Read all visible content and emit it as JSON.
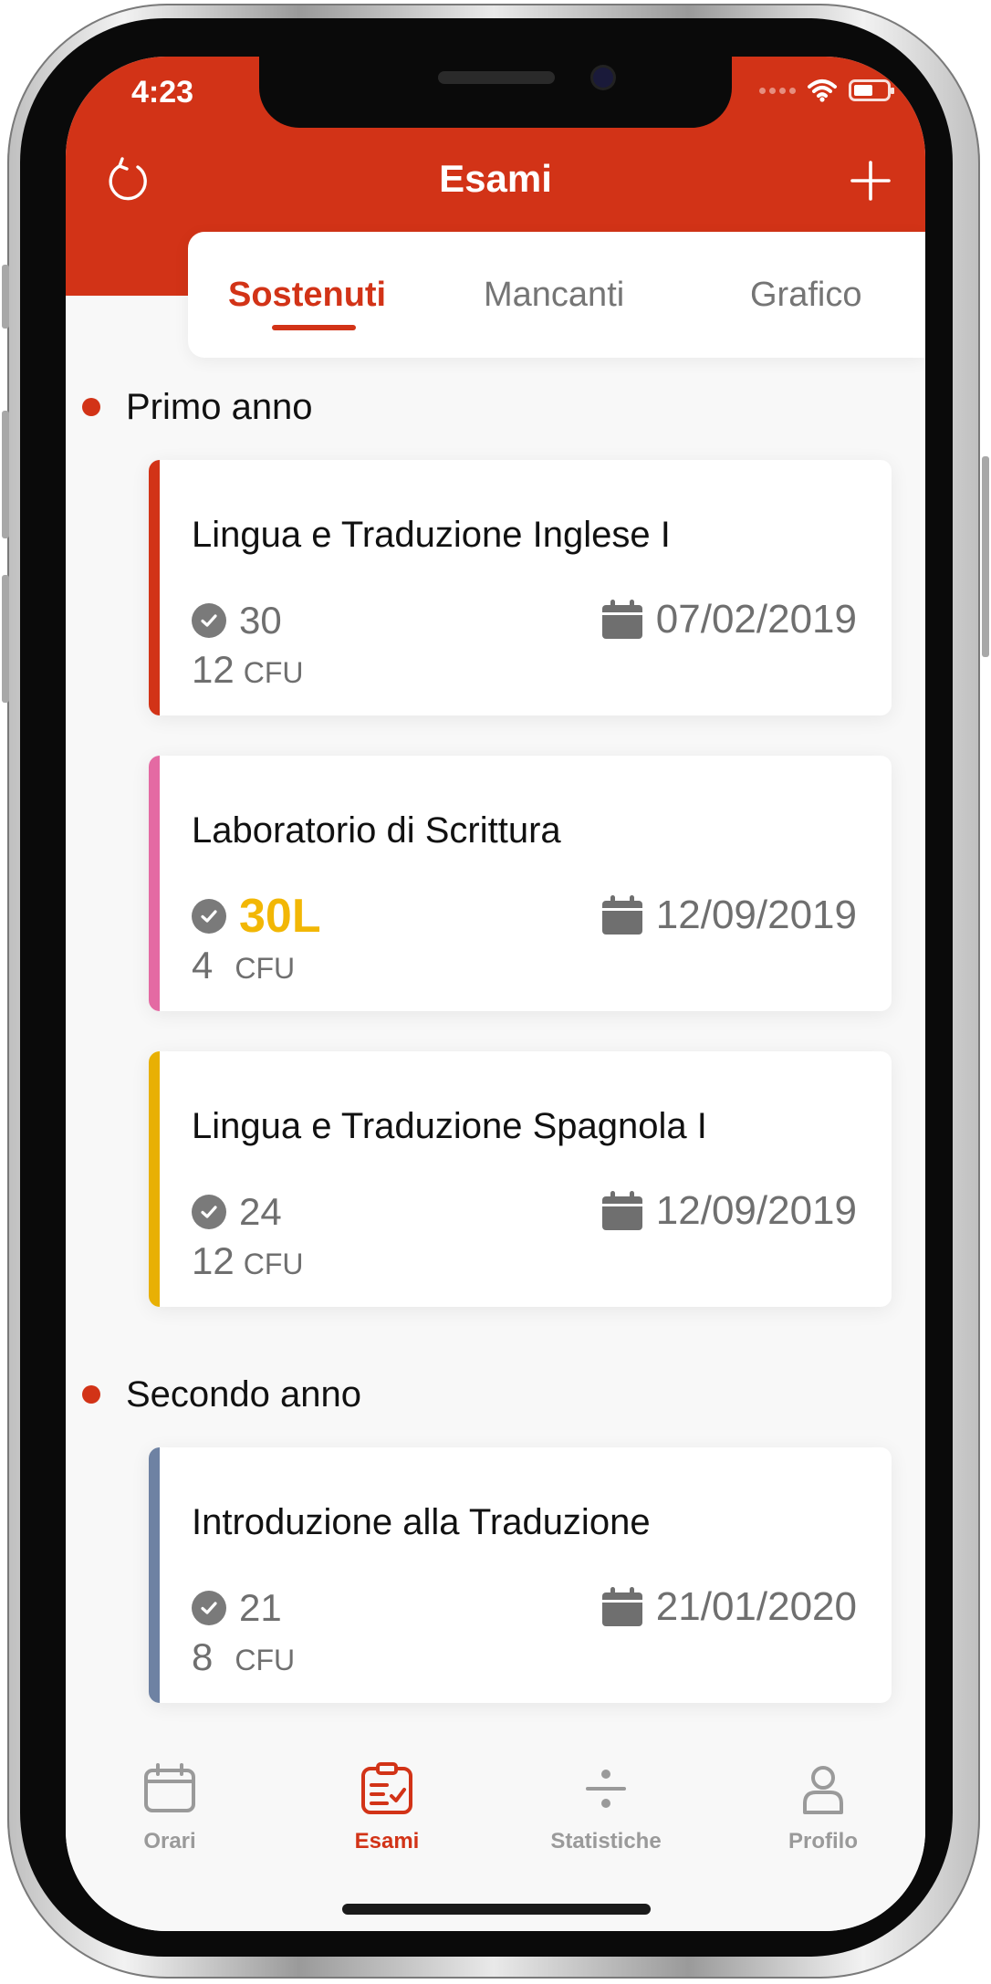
{
  "status_bar": {
    "time": "4:23"
  },
  "header": {
    "title": "Esami"
  },
  "tabs": [
    {
      "label": "Sostenuti",
      "active": true
    },
    {
      "label": "Mancanti",
      "active": false
    },
    {
      "label": "Grafico",
      "active": false
    }
  ],
  "sections": [
    {
      "title": "Primo anno",
      "exams": [
        {
          "name": "Lingua e Traduzione Inglese I",
          "grade": "30",
          "cfu": "12",
          "cfu_label": "CFU",
          "date": "07/02/2019",
          "accent": "#d23317"
        },
        {
          "name": "Laboratorio di Scrittura",
          "grade": "30L",
          "cfu": "4",
          "cfu_label": "CFU",
          "date": "12/09/2019",
          "accent": "#e46aa3"
        },
        {
          "name": "Lingua e Traduzione Spagnola I",
          "grade": "24",
          "cfu": "12",
          "cfu_label": "CFU",
          "date": "12/09/2019",
          "accent": "#e8b004"
        }
      ]
    },
    {
      "title": "Secondo anno",
      "exams": [
        {
          "name": "Introduzione alla Traduzione",
          "grade": "21",
          "cfu": "8",
          "cfu_label": "CFU",
          "date": "21/01/2020",
          "accent": "#6e82a3"
        }
      ]
    }
  ],
  "bottom_nav": [
    {
      "label": "Orari",
      "icon": "calendar-icon",
      "active": false
    },
    {
      "label": "Esami",
      "icon": "exam-icon",
      "active": true
    },
    {
      "label": "Statistiche",
      "icon": "divide-icon",
      "active": false
    },
    {
      "label": "Profilo",
      "icon": "person-icon",
      "active": false
    }
  ],
  "colors": {
    "accent": "#d23317",
    "lode": "#f2b705",
    "muted": "#6f6f6f"
  }
}
